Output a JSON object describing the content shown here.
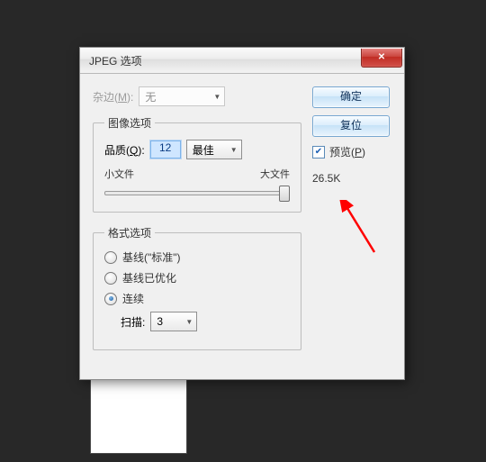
{
  "dialog": {
    "title": "JPEG 选项",
    "matte_label": "杂边(M):",
    "matte_value": "无",
    "group_image": {
      "legend": "图像选项",
      "quality_label": "品质(Q):",
      "quality_value": "12",
      "quality_preset": "最佳",
      "small_label": "小文件",
      "large_label": "大文件"
    },
    "group_format": {
      "legend": "格式选项",
      "opt_baseline": "基线(\"标准\")",
      "opt_optimized": "基线已优化",
      "opt_progressive": "连续",
      "scans_label": "扫描:",
      "scans_value": "3"
    },
    "buttons": {
      "ok": "确定",
      "reset": "复位"
    },
    "preview_label": "预览(P)",
    "filesize": "26.5K"
  }
}
